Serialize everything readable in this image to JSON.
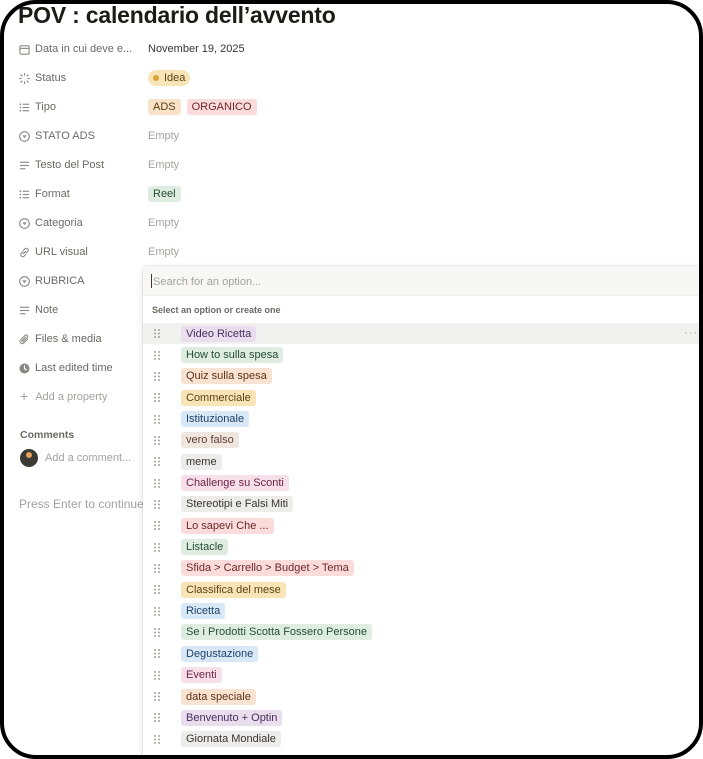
{
  "page": {
    "title": "POV : calendario dell’avvento"
  },
  "properties": [
    {
      "icon": "calendar-icon",
      "label": "Data in cui deve e...",
      "value": "November 19, 2025",
      "type": "text"
    },
    {
      "icon": "status-icon",
      "label": "Status",
      "type": "status",
      "tags": [
        {
          "text": "Idea",
          "bg": "#f9e4b8",
          "fg": "#5c4211"
        }
      ]
    },
    {
      "icon": "list-icon",
      "label": "Tipo",
      "type": "tags",
      "tags": [
        {
          "text": "ADS",
          "bg": "#f8e3c8",
          "fg": "#5c3b10"
        },
        {
          "text": "ORGANICO",
          "bg": "#fbdcdc",
          "fg": "#6e2626"
        }
      ]
    },
    {
      "icon": "select-icon",
      "label": "STATO ADS",
      "value": "Empty",
      "type": "empty"
    },
    {
      "icon": "text-icon",
      "label": "Testo del Post",
      "value": "Empty",
      "type": "empty"
    },
    {
      "icon": "list-icon",
      "label": "Format",
      "type": "tags",
      "tags": [
        {
          "text": "Reel",
          "bg": "#dfece2",
          "fg": "#264d32"
        }
      ]
    },
    {
      "icon": "select-icon",
      "label": "Categoria",
      "value": "Empty",
      "type": "empty"
    },
    {
      "icon": "link-icon",
      "label": "URL visual",
      "value": "Empty",
      "type": "empty"
    },
    {
      "icon": "select-icon",
      "label": "RUBRICA",
      "value": "",
      "type": "empty"
    },
    {
      "icon": "text-icon",
      "label": "Note",
      "value": "",
      "type": "empty"
    },
    {
      "icon": "paperclip-icon",
      "label": "Files & media",
      "value": "",
      "type": "empty"
    },
    {
      "icon": "clock-icon",
      "label": "Last edited time",
      "value": "",
      "type": "empty"
    }
  ],
  "add_property": "Add a property",
  "comments": {
    "title": "Comments",
    "placeholder": "Add a comment..."
  },
  "press_enter": "Press Enter to continue",
  "dropdown": {
    "search_placeholder": "Search for an option...",
    "hint": "Select an option or create one",
    "more_label": "···",
    "options": [
      {
        "text": "Video Ricetta",
        "bg": "#e8deee",
        "fg": "#4a2e5c"
      },
      {
        "text": "How to sulla spesa",
        "bg": "#dfece2",
        "fg": "#264d32"
      },
      {
        "text": "Quiz sulla spesa",
        "bg": "#f8e3d3",
        "fg": "#5c3214"
      },
      {
        "text": "Commerciale",
        "bg": "#f9e4b8",
        "fg": "#5c4211"
      },
      {
        "text": "Istituzionale",
        "bg": "#d9e8f6",
        "fg": "#1d4268"
      },
      {
        "text": "vero falso",
        "bg": "#f0e6e0",
        "fg": "#5c3d30"
      },
      {
        "text": "meme",
        "bg": "#ececea",
        "fg": "#37352f"
      },
      {
        "text": "Challenge su Sconti",
        "bg": "#f6dfe9",
        "fg": "#6e2449"
      },
      {
        "text": "Stereotipi e Falsi Miti",
        "bg": "#ececea",
        "fg": "#37352f"
      },
      {
        "text": "Lo sapevi Che ...",
        "bg": "#fbdcdc",
        "fg": "#6e2626"
      },
      {
        "text": "Listacle",
        "bg": "#dfece2",
        "fg": "#264d32"
      },
      {
        "text": "Sfida > Carrello > Budget > Tema",
        "bg": "#fbdcdc",
        "fg": "#6e2626"
      },
      {
        "text": "Classifica del mese",
        "bg": "#f9e4b8",
        "fg": "#5c4211"
      },
      {
        "text": "Ricetta",
        "bg": "#d9e8f6",
        "fg": "#1d4268"
      },
      {
        "text": "Se i Prodotti Scotta Fossero Persone",
        "bg": "#dfece2",
        "fg": "#264d32"
      },
      {
        "text": "Degustazione",
        "bg": "#d9e8f6",
        "fg": "#1d4268"
      },
      {
        "text": "Eventi",
        "bg": "#f6dfe9",
        "fg": "#6e2449"
      },
      {
        "text": "data speciale",
        "bg": "#f8e3d3",
        "fg": "#5c3214"
      },
      {
        "text": "Benvenuto + Optin",
        "bg": "#e8deee",
        "fg": "#4a2e5c"
      },
      {
        "text": "Giornata Mondiale",
        "bg": "#ececea",
        "fg": "#37352f"
      }
    ]
  }
}
